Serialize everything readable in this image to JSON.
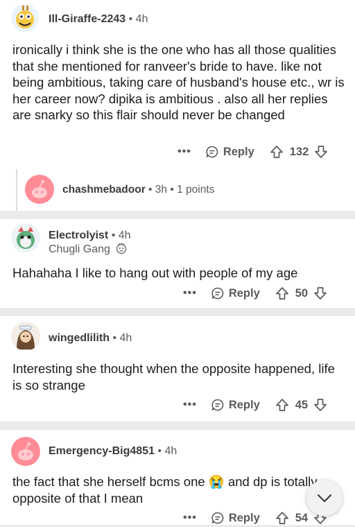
{
  "comments": [
    {
      "username": "Ill-Giraffe-2243",
      "time": "4h",
      "body": "ironically i think she is the one who has all those qualities that she mentioned for ranveer's bride to have. like not being ambitious, taking care of husband's house etc., wr is her career now? dipika is ambitious . also all her replies are snarky so this flair should never be changed",
      "reply_label": "Reply",
      "votes": "132"
    },
    {
      "username": "chashmebadoor",
      "time": "3h",
      "points": "1 points"
    },
    {
      "username": "Electrolyist",
      "time": "4h",
      "flair": "Chugli Gang",
      "body": "Hahahaha I like to hang out with people of my age",
      "reply_label": "Reply",
      "votes": "50"
    },
    {
      "username": "wingedlilith",
      "time": "4h",
      "body": "Interesting she thought when the opposite happened, life is so strange",
      "reply_label": "Reply",
      "votes": "45"
    },
    {
      "username": "Emergency-Big4851",
      "time": "4h",
      "body_part1": "the fact that she herself bcms one ",
      "emoji": "😭",
      "body_part2": " and dp is totally opposite of that I mean",
      "reply_label": "Reply",
      "votes": "54"
    }
  ],
  "separator": "•",
  "more_label": "•••",
  "icons": {
    "reply": "reply-icon",
    "upvote": "upvote-arrow-icon",
    "downvote": "downvote-arrow-icon",
    "scroll_down": "chevron-down-icon"
  },
  "colors": {
    "snoo_pink": "#ff8c96",
    "background": "#ebebeb",
    "text": "#1c1c1c"
  }
}
